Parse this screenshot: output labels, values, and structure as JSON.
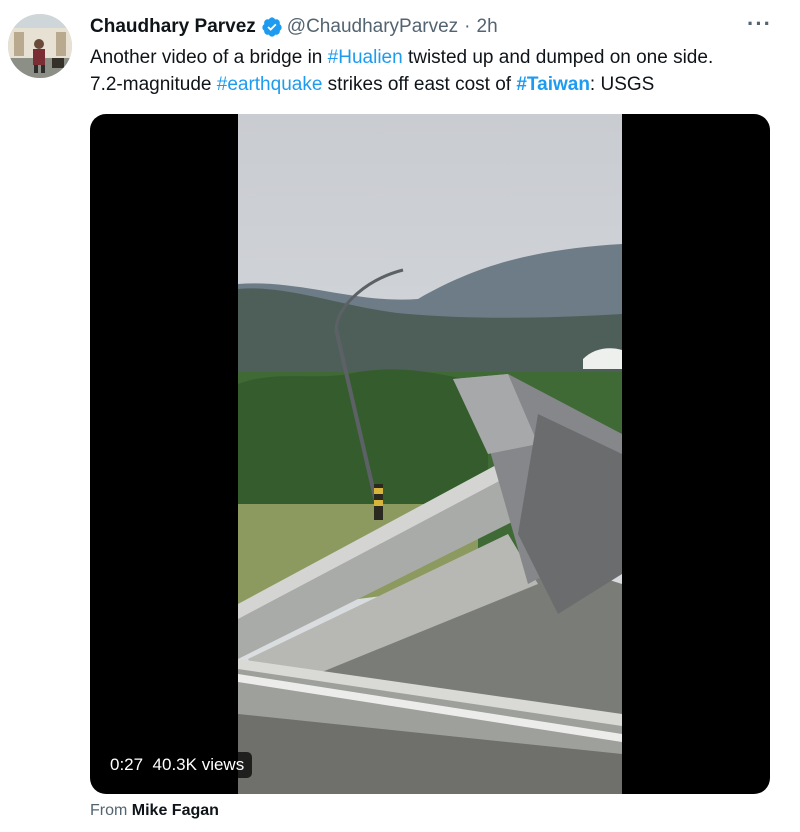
{
  "tweet": {
    "display_name": "Chaudhary Parvez",
    "handle": "@ChaudharyParvez",
    "separator": "·",
    "time": "2h",
    "more": "···",
    "text_line1_a": "Another video of a bridge in ",
    "hashtag1": "#Hualien",
    "text_line1_b": " twisted up and dumped on one side.",
    "text_line2_a": "7.2-magnitude ",
    "hashtag2": "#earthquake",
    "text_line2_b": " strikes off east cost of ",
    "hashtag3": "#Taiwan",
    "text_line2_c": ": USGS"
  },
  "video": {
    "duration": "0:27",
    "views": "40.3K views"
  },
  "source": {
    "prefix": "From ",
    "author": "Mike Fagan"
  },
  "colors": {
    "link": "#1d9bf0",
    "secondary_text": "#536471",
    "primary_text": "#0f1419",
    "verified_badge": "#1d9bf0"
  }
}
